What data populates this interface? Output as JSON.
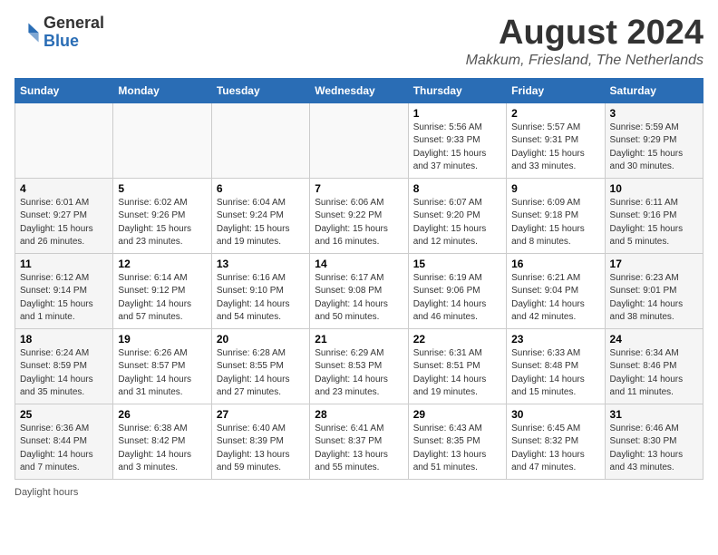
{
  "header": {
    "logo_general": "General",
    "logo_blue": "Blue",
    "title": "August 2024",
    "subtitle": "Makkum, Friesland, The Netherlands"
  },
  "days_of_week": [
    "Sunday",
    "Monday",
    "Tuesday",
    "Wednesday",
    "Thursday",
    "Friday",
    "Saturday"
  ],
  "footer": "Daylight hours",
  "weeks": [
    [
      {
        "day": "",
        "sunrise": "",
        "sunset": "",
        "daylight": "",
        "empty": true
      },
      {
        "day": "",
        "sunrise": "",
        "sunset": "",
        "daylight": "",
        "empty": true
      },
      {
        "day": "",
        "sunrise": "",
        "sunset": "",
        "daylight": "",
        "empty": true
      },
      {
        "day": "",
        "sunrise": "",
        "sunset": "",
        "daylight": "",
        "empty": true
      },
      {
        "day": "1",
        "sunrise": "Sunrise: 5:56 AM",
        "sunset": "Sunset: 9:33 PM",
        "daylight": "Daylight: 15 hours and 37 minutes.",
        "empty": false
      },
      {
        "day": "2",
        "sunrise": "Sunrise: 5:57 AM",
        "sunset": "Sunset: 9:31 PM",
        "daylight": "Daylight: 15 hours and 33 minutes.",
        "empty": false
      },
      {
        "day": "3",
        "sunrise": "Sunrise: 5:59 AM",
        "sunset": "Sunset: 9:29 PM",
        "daylight": "Daylight: 15 hours and 30 minutes.",
        "empty": false
      }
    ],
    [
      {
        "day": "4",
        "sunrise": "Sunrise: 6:01 AM",
        "sunset": "Sunset: 9:27 PM",
        "daylight": "Daylight: 15 hours and 26 minutes.",
        "empty": false
      },
      {
        "day": "5",
        "sunrise": "Sunrise: 6:02 AM",
        "sunset": "Sunset: 9:26 PM",
        "daylight": "Daylight: 15 hours and 23 minutes.",
        "empty": false
      },
      {
        "day": "6",
        "sunrise": "Sunrise: 6:04 AM",
        "sunset": "Sunset: 9:24 PM",
        "daylight": "Daylight: 15 hours and 19 minutes.",
        "empty": false
      },
      {
        "day": "7",
        "sunrise": "Sunrise: 6:06 AM",
        "sunset": "Sunset: 9:22 PM",
        "daylight": "Daylight: 15 hours and 16 minutes.",
        "empty": false
      },
      {
        "day": "8",
        "sunrise": "Sunrise: 6:07 AM",
        "sunset": "Sunset: 9:20 PM",
        "daylight": "Daylight: 15 hours and 12 minutes.",
        "empty": false
      },
      {
        "day": "9",
        "sunrise": "Sunrise: 6:09 AM",
        "sunset": "Sunset: 9:18 PM",
        "daylight": "Daylight: 15 hours and 8 minutes.",
        "empty": false
      },
      {
        "day": "10",
        "sunrise": "Sunrise: 6:11 AM",
        "sunset": "Sunset: 9:16 PM",
        "daylight": "Daylight: 15 hours and 5 minutes.",
        "empty": false
      }
    ],
    [
      {
        "day": "11",
        "sunrise": "Sunrise: 6:12 AM",
        "sunset": "Sunset: 9:14 PM",
        "daylight": "Daylight: 15 hours and 1 minute.",
        "empty": false
      },
      {
        "day": "12",
        "sunrise": "Sunrise: 6:14 AM",
        "sunset": "Sunset: 9:12 PM",
        "daylight": "Daylight: 14 hours and 57 minutes.",
        "empty": false
      },
      {
        "day": "13",
        "sunrise": "Sunrise: 6:16 AM",
        "sunset": "Sunset: 9:10 PM",
        "daylight": "Daylight: 14 hours and 54 minutes.",
        "empty": false
      },
      {
        "day": "14",
        "sunrise": "Sunrise: 6:17 AM",
        "sunset": "Sunset: 9:08 PM",
        "daylight": "Daylight: 14 hours and 50 minutes.",
        "empty": false
      },
      {
        "day": "15",
        "sunrise": "Sunrise: 6:19 AM",
        "sunset": "Sunset: 9:06 PM",
        "daylight": "Daylight: 14 hours and 46 minutes.",
        "empty": false
      },
      {
        "day": "16",
        "sunrise": "Sunrise: 6:21 AM",
        "sunset": "Sunset: 9:04 PM",
        "daylight": "Daylight: 14 hours and 42 minutes.",
        "empty": false
      },
      {
        "day": "17",
        "sunrise": "Sunrise: 6:23 AM",
        "sunset": "Sunset: 9:01 PM",
        "daylight": "Daylight: 14 hours and 38 minutes.",
        "empty": false
      }
    ],
    [
      {
        "day": "18",
        "sunrise": "Sunrise: 6:24 AM",
        "sunset": "Sunset: 8:59 PM",
        "daylight": "Daylight: 14 hours and 35 minutes.",
        "empty": false
      },
      {
        "day": "19",
        "sunrise": "Sunrise: 6:26 AM",
        "sunset": "Sunset: 8:57 PM",
        "daylight": "Daylight: 14 hours and 31 minutes.",
        "empty": false
      },
      {
        "day": "20",
        "sunrise": "Sunrise: 6:28 AM",
        "sunset": "Sunset: 8:55 PM",
        "daylight": "Daylight: 14 hours and 27 minutes.",
        "empty": false
      },
      {
        "day": "21",
        "sunrise": "Sunrise: 6:29 AM",
        "sunset": "Sunset: 8:53 PM",
        "daylight": "Daylight: 14 hours and 23 minutes.",
        "empty": false
      },
      {
        "day": "22",
        "sunrise": "Sunrise: 6:31 AM",
        "sunset": "Sunset: 8:51 PM",
        "daylight": "Daylight: 14 hours and 19 minutes.",
        "empty": false
      },
      {
        "day": "23",
        "sunrise": "Sunrise: 6:33 AM",
        "sunset": "Sunset: 8:48 PM",
        "daylight": "Daylight: 14 hours and 15 minutes.",
        "empty": false
      },
      {
        "day": "24",
        "sunrise": "Sunrise: 6:34 AM",
        "sunset": "Sunset: 8:46 PM",
        "daylight": "Daylight: 14 hours and 11 minutes.",
        "empty": false
      }
    ],
    [
      {
        "day": "25",
        "sunrise": "Sunrise: 6:36 AM",
        "sunset": "Sunset: 8:44 PM",
        "daylight": "Daylight: 14 hours and 7 minutes.",
        "empty": false
      },
      {
        "day": "26",
        "sunrise": "Sunrise: 6:38 AM",
        "sunset": "Sunset: 8:42 PM",
        "daylight": "Daylight: 14 hours and 3 minutes.",
        "empty": false
      },
      {
        "day": "27",
        "sunrise": "Sunrise: 6:40 AM",
        "sunset": "Sunset: 8:39 PM",
        "daylight": "Daylight: 13 hours and 59 minutes.",
        "empty": false
      },
      {
        "day": "28",
        "sunrise": "Sunrise: 6:41 AM",
        "sunset": "Sunset: 8:37 PM",
        "daylight": "Daylight: 13 hours and 55 minutes.",
        "empty": false
      },
      {
        "day": "29",
        "sunrise": "Sunrise: 6:43 AM",
        "sunset": "Sunset: 8:35 PM",
        "daylight": "Daylight: 13 hours and 51 minutes.",
        "empty": false
      },
      {
        "day": "30",
        "sunrise": "Sunrise: 6:45 AM",
        "sunset": "Sunset: 8:32 PM",
        "daylight": "Daylight: 13 hours and 47 minutes.",
        "empty": false
      },
      {
        "day": "31",
        "sunrise": "Sunrise: 6:46 AM",
        "sunset": "Sunset: 8:30 PM",
        "daylight": "Daylight: 13 hours and 43 minutes.",
        "empty": false
      }
    ]
  ]
}
